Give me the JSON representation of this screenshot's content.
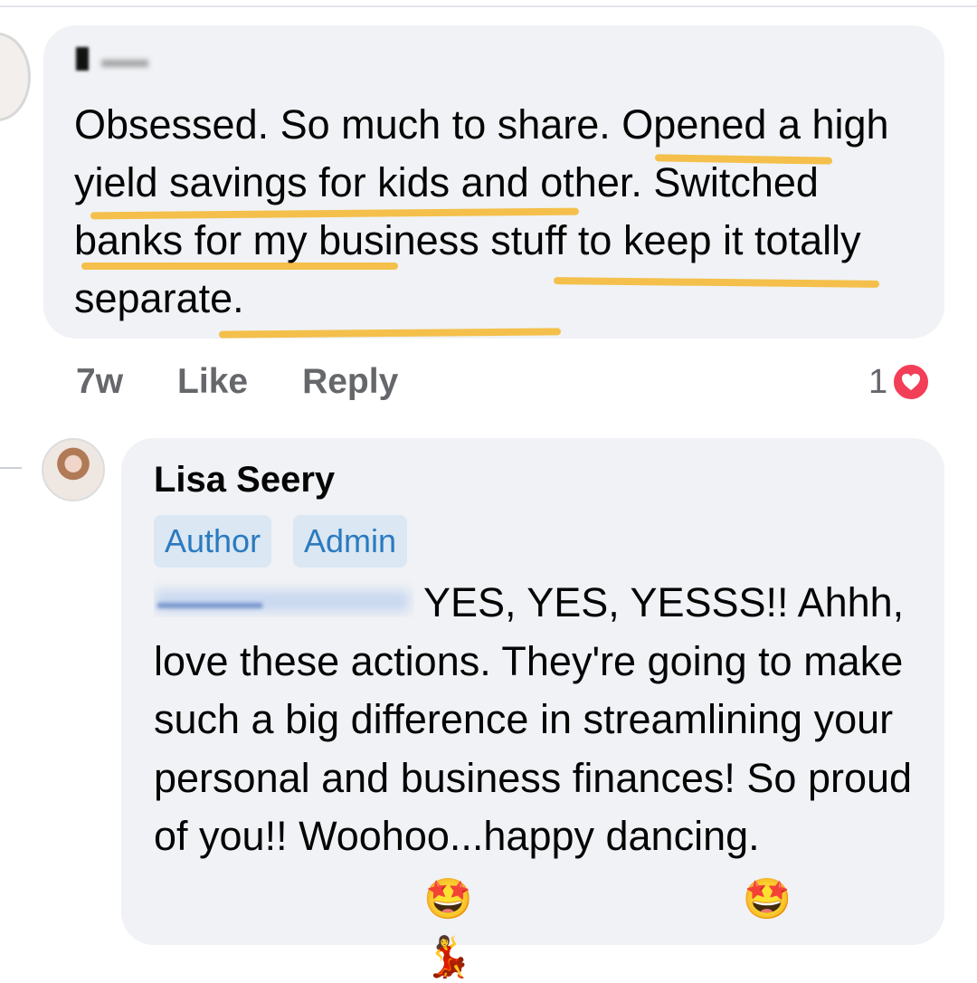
{
  "comment1": {
    "text": "Obsessed. So much to share. Opened a high yield savings for kids and other. Switched banks for my business stuff to keep it totally separate.",
    "time": "7w",
    "like_label": "Like",
    "reply_label": "Reply",
    "reaction_count": "1",
    "reaction_icon": "heart-icon"
  },
  "reply": {
    "author": "Lisa Seery",
    "badges": [
      "Author",
      "Admin"
    ],
    "text": "YES, YES, YESSS!! Ahhh, love these actions. They're going to make such a big difference in streamlining your personal and business finances! So proud of you!! Woohoo...happy dancing.",
    "emojis": [
      "🤩",
      "🤩",
      "💃"
    ]
  },
  "colors": {
    "bubble": "#f0f2f5",
    "highlight": "#f3bd41",
    "badge_bg": "#dbe7f2",
    "badge_text": "#2a7ac0",
    "meta": "#65676b",
    "heart": "#f33e58"
  }
}
